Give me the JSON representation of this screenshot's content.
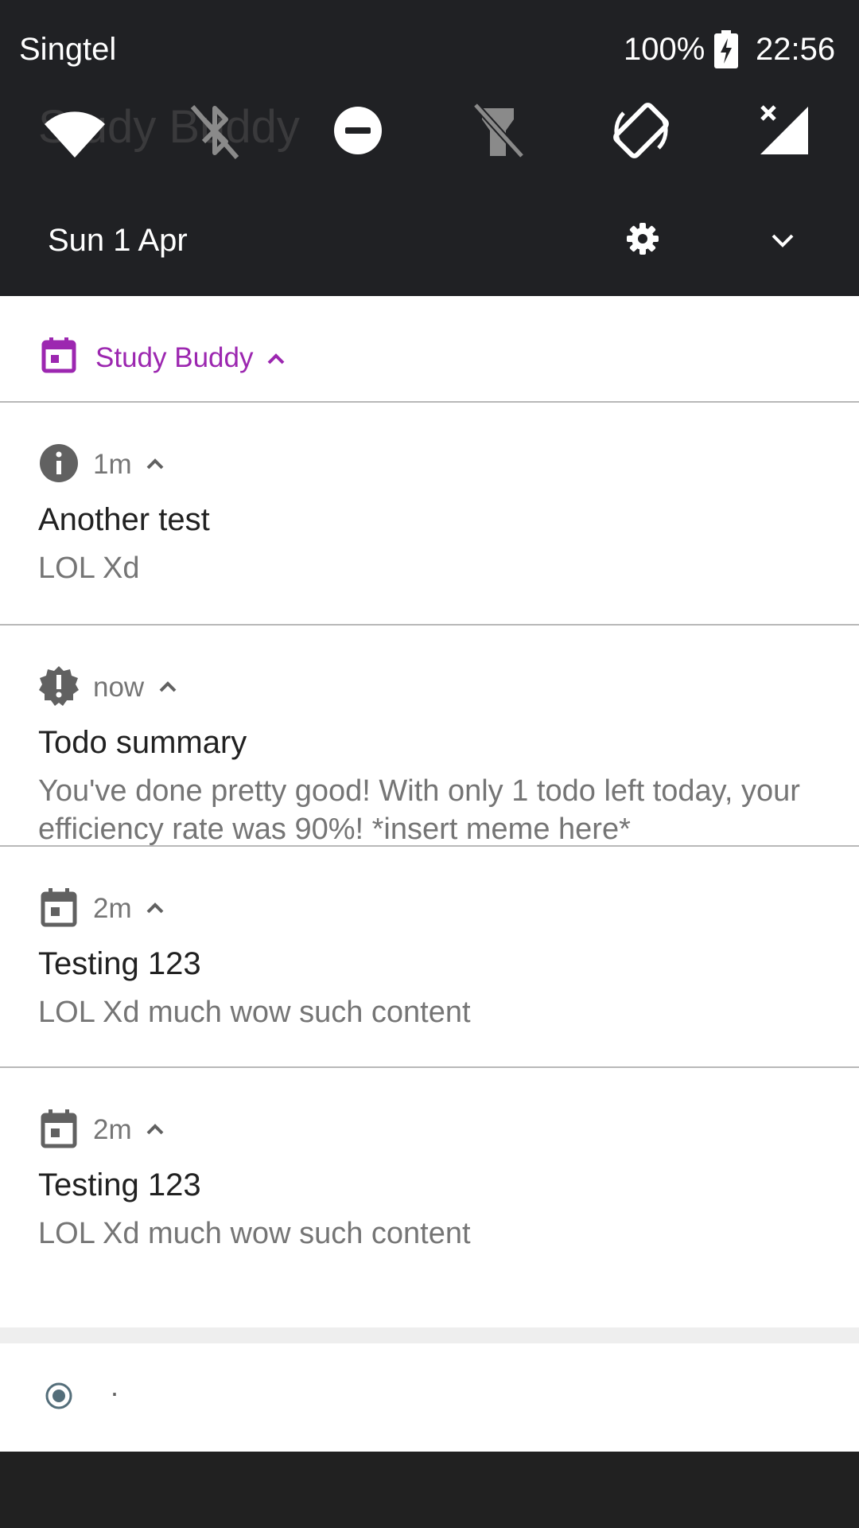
{
  "status_bar": {
    "carrier": "Singtel",
    "battery": "100%",
    "time": "22:56"
  },
  "background_app_title": "Study Buddy",
  "quick_settings": {
    "tiles": [
      "wifi-icon",
      "bluetooth-off-icon",
      "do-not-disturb-icon",
      "flashlight-off-icon",
      "auto-rotate-icon",
      "mobile-data-off-icon"
    ]
  },
  "date_row": {
    "date": "Sun 1 Apr"
  },
  "notification_group": {
    "app_name": "Study Buddy",
    "accent_color": "#9c27b0",
    "items": [
      {
        "icon": "info-icon",
        "time": "1m",
        "title": "Another test",
        "body": "LOL Xd"
      },
      {
        "icon": "alert-badge-icon",
        "time": "now",
        "title": "Todo summary",
        "body": "You've done pretty good! With only 1 todo left today, your efficiency rate was 90%! *insert meme here*"
      },
      {
        "icon": "calendar-icon",
        "time": "2m",
        "title": "Testing 123",
        "body": "LOL Xd much wow such content"
      },
      {
        "icon": "calendar-icon",
        "time": "2m",
        "title": "Testing 123",
        "body": "LOL Xd much wow such content"
      }
    ]
  },
  "footer_notification": {
    "icon": "radio-target-icon",
    "text": "·"
  }
}
